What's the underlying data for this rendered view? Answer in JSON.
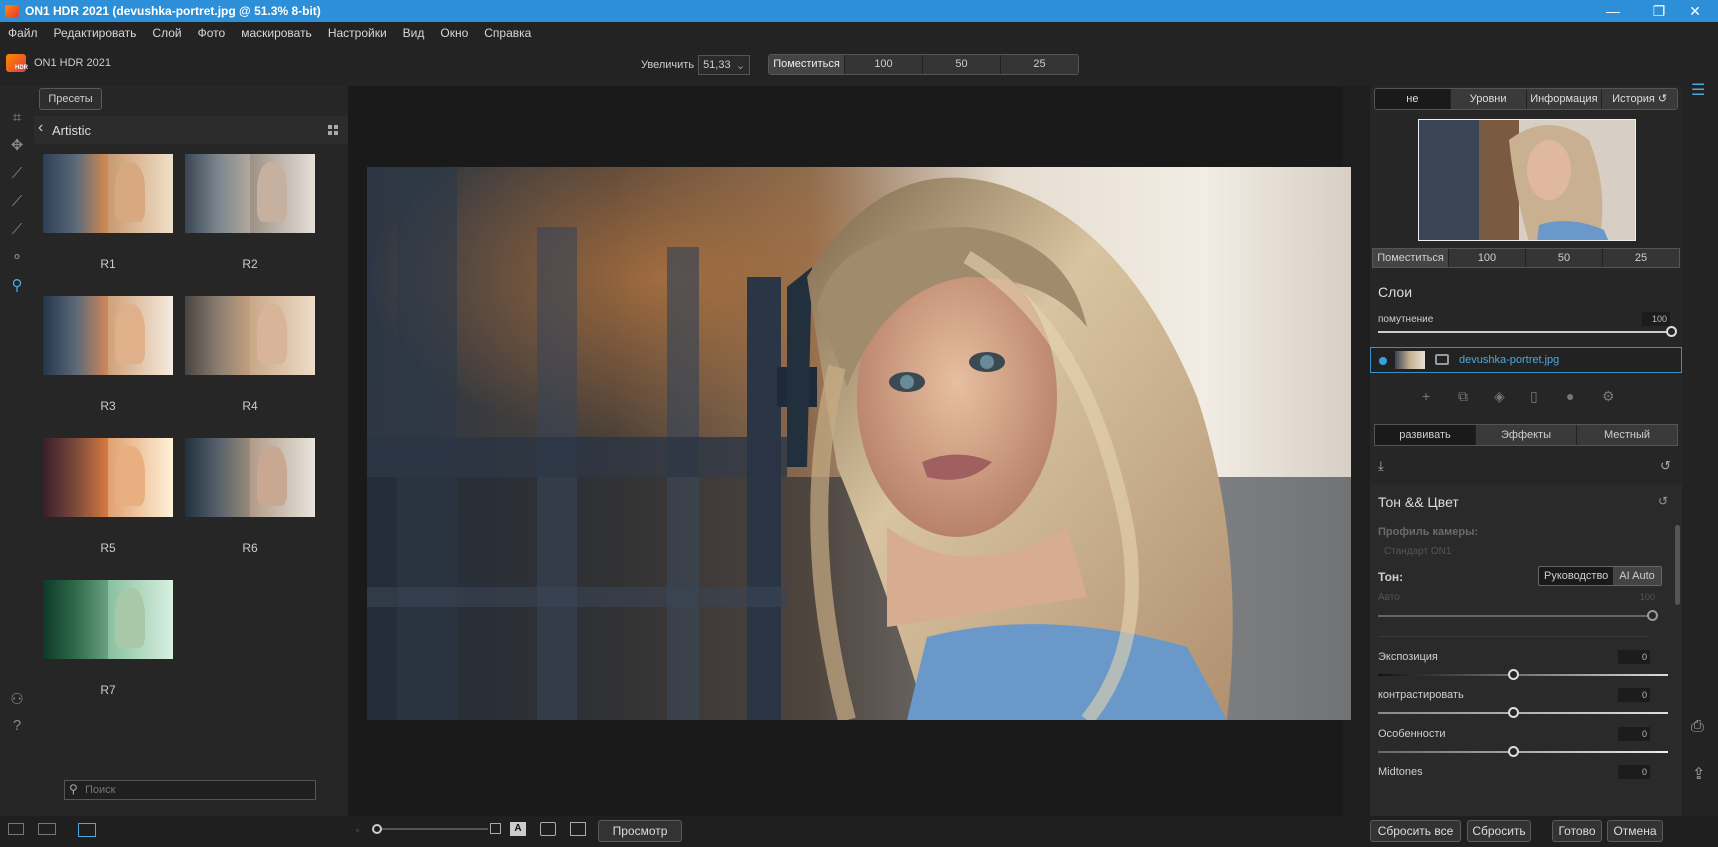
{
  "window": {
    "title": "ON1 HDR 2021 (devushka-portret.jpg @ 51.3% 8-bit)",
    "minimize": "—",
    "restore": "❐",
    "close": "✕"
  },
  "menu": [
    "Файл",
    "Редактировать",
    "Слой",
    "Фото",
    "маскировать",
    "Настройки",
    "Вид",
    "Окно",
    "Справка"
  ],
  "app_name": "ON1 HDR 2021",
  "zoom": {
    "label": "Увеличить",
    "value": "51,33",
    "chevron": "⌄"
  },
  "zoom_buttons": [
    "Поместиться",
    "100",
    "50",
    "25"
  ],
  "left_panel": {
    "presets_button": "Пресеты",
    "category": "Artistic",
    "presets": [
      "R1",
      "R2",
      "R3",
      "R4",
      "R5",
      "R6",
      "R7"
    ],
    "search_placeholder": "Поиск"
  },
  "right_panel": {
    "tabs": [
      "не",
      "Уровни",
      "Информация",
      "История"
    ],
    "history_icon": "↺",
    "nav_zoom_buttons": [
      "Поместиться",
      "100",
      "50",
      "25"
    ],
    "layers_title": "Слои",
    "opacity_label": "помутнение",
    "opacity_value": "100",
    "layer_name": "devushka-portret.jpg",
    "module_tabs": [
      "развивать",
      "Эффекты",
      "Местный"
    ],
    "section_title": "Тон && Цвет",
    "camera_profile_label": "Профиль камеры:",
    "camera_profile_value": "Стандарт ON1",
    "tone_label": "Тон:",
    "tone_modes": [
      "Руководство",
      "AI Auto"
    ],
    "auto_label": "Авто",
    "auto_value": "100",
    "sliders": [
      {
        "label": "Экспозиция",
        "value": "0"
      },
      {
        "label": "контрастировать",
        "value": "0"
      },
      {
        "label": "Особенности",
        "value": "0"
      },
      {
        "label": "Midtones",
        "value": "0"
      }
    ]
  },
  "bottom": {
    "preview_button": "Просмотр",
    "reset_all": "Сбросить все",
    "reset": "Сбросить",
    "done": "Готово",
    "cancel": "Отмена"
  }
}
